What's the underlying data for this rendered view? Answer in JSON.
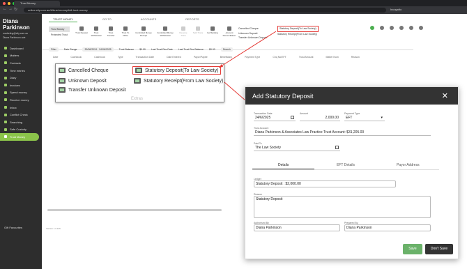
{
  "browser": {
    "tab_title": "Trust Money",
    "url": "online.sily.com.au/#/trust-money/full-trust-money",
    "profile": "Incognito"
  },
  "sidebar": {
    "user_name": "Diana Parkinson",
    "user_email": "marketing@sily.com.au",
    "user_role": "Diana Parkinson ade",
    "items": [
      {
        "label": "Dashboard"
      },
      {
        "label": "Matters"
      },
      {
        "label": "Contacts"
      },
      {
        "label": "Time entries"
      },
      {
        "label": "Diary"
      },
      {
        "label": "Invoices"
      },
      {
        "label": "Spend money"
      },
      {
        "label": "Receive money"
      },
      {
        "label": "Inbox"
      },
      {
        "label": "Conflict Check"
      },
      {
        "label": "Searching"
      },
      {
        "label": "Safe Custody"
      },
      {
        "label": "Trust Money"
      }
    ],
    "footer": "Gift Favourites",
    "version": "Version 1.0.135"
  },
  "ribbon": {
    "tabs": [
      "TRUST MONEY",
      "GO TO",
      "ACCOUNTS",
      "REPORTS"
    ],
    "left_items": [
      "Trust Money",
      "Protected Trust"
    ],
    "buttons": [
      {
        "label": "Trust Receipt"
      },
      {
        "label": "Trust Withdrawal"
      },
      {
        "label": "Trust Transfer"
      },
      {
        "label": "Trust To Office"
      },
      {
        "label": "Controlled Money Receipt"
      },
      {
        "label": "Controlled Money Withdrawal"
      },
      {
        "label": "Reverse Trans",
        "dim": true
      },
      {
        "label": "Split Trans",
        "dim": true
      },
      {
        "label": "Go Banking"
      },
      {
        "label": "Account Reconciliation"
      }
    ],
    "extras_col1": [
      "Cancelled Cheque",
      "Unknown Deposit",
      "Transfer Unknown Deposit"
    ],
    "extras_col2": [
      "Statutory Deposit(To Law Society)",
      "Statutory Receipt(From Law Society)"
    ]
  },
  "filter_bar": {
    "filter": "Filter",
    "date_range_label": "Date Range",
    "date_range": "30/06/2024 - 24/06/2025",
    "trust_balance_label": "Trust Balance",
    "trust_balance": "$0.00",
    "last_rec_date_label": "Last Trust Rec Date",
    "last_rec_balance_label": "Last Trust Rec Balance",
    "last_rec_balance": "$0.00",
    "search": "Search"
  },
  "table_headers": [
    "Date",
    "Cashbook",
    "Cashbook",
    "Type",
    "Transaction Date",
    "Date Entered",
    "Payor/Payee",
    "Beneficiary",
    "Payment Type",
    "Chq No/EFT",
    "Trust Amount",
    "Matter Num",
    "Reason"
  ],
  "zoom": {
    "col1": [
      "Cancelled Cheque",
      "Unknown Deposit",
      "Transfer Unknown Deposit"
    ],
    "col2": [
      "Statutory Deposit(To Law Society)",
      "Statutory Receipt(From Law Society)"
    ],
    "extras": "Extras"
  },
  "modal": {
    "title": "Add Statutory Deposit",
    "transaction_date_label": "Transaction Date",
    "transaction_date": "24/6/2025",
    "amount_label": "Amount",
    "amount": "2,000.00",
    "payment_type_label": "Payment Type",
    "payment_type": "EFT",
    "trust_account_label": "Trust Account",
    "trust_account": "Diana Parkinson & Associates Law Practice Trust Account: $31,205.00",
    "paid_to_label": "Paid To",
    "paid_to": "The Law Society",
    "tabs": [
      "Details",
      "EFT Details",
      "Payor Address"
    ],
    "ledger_label": "Ledger",
    "ledger": "Statutory Deposit : $2,000.00",
    "reason_label": "Reason",
    "reason": "Statutory Deposit",
    "authorised_by_label": "Authorised By",
    "authorised_by": "Diana Parkinson",
    "prepared_by_label": "Prepared By",
    "prepared_by": "Diana Parkinson",
    "save": "Save",
    "dont_save": "Don't Save"
  },
  "colors": {
    "accent": "#8bc34a",
    "highlight": "#e53935",
    "dark": "#333333"
  }
}
